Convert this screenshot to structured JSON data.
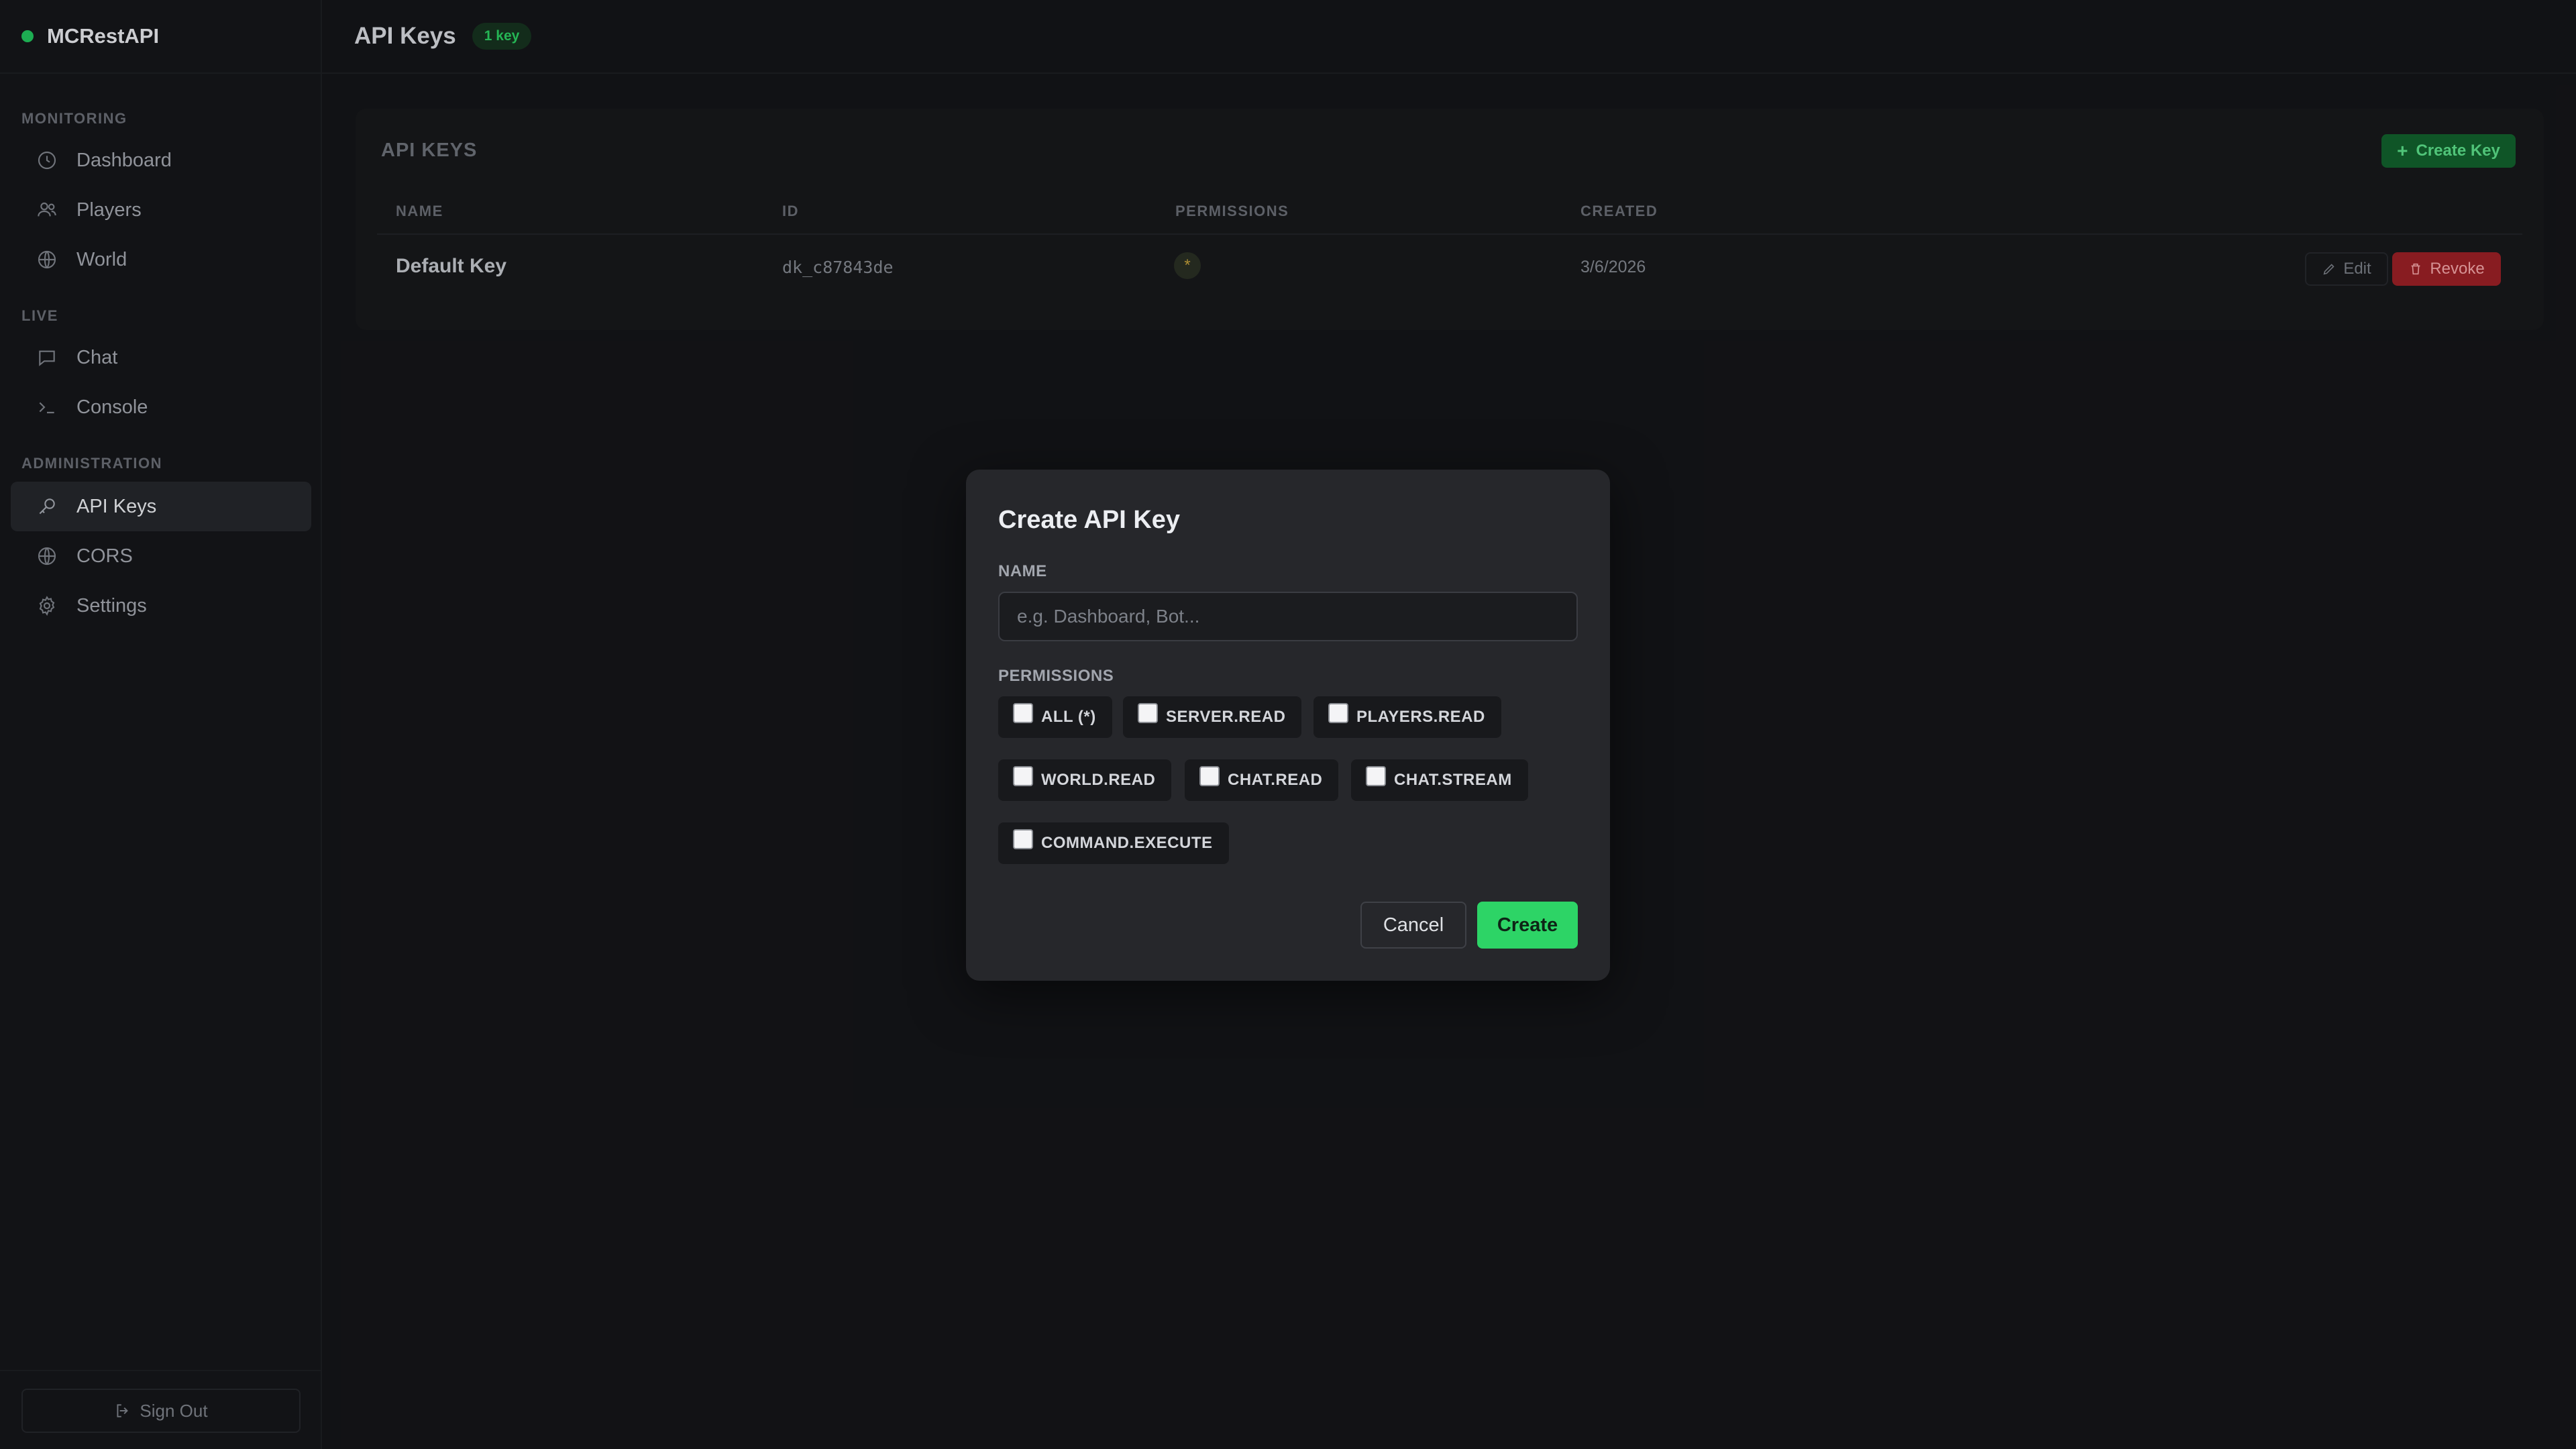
{
  "app": {
    "name": "MCRestAPI",
    "status_color": "#22c55e"
  },
  "sidebar": {
    "sections": [
      {
        "label": "MONITORING",
        "items": [
          {
            "label": "Dashboard",
            "icon": "clock-icon"
          },
          {
            "label": "Players",
            "icon": "users-icon"
          },
          {
            "label": "World",
            "icon": "globe-icon"
          }
        ]
      },
      {
        "label": "LIVE",
        "items": [
          {
            "label": "Chat",
            "icon": "chat-icon"
          },
          {
            "label": "Console",
            "icon": "terminal-icon"
          }
        ]
      },
      {
        "label": "ADMINISTRATION",
        "items": [
          {
            "label": "API Keys",
            "icon": "key-icon",
            "active": true
          },
          {
            "label": "CORS",
            "icon": "globe-icon"
          },
          {
            "label": "Settings",
            "icon": "gear-icon"
          }
        ]
      }
    ],
    "sign_out_label": "Sign Out"
  },
  "header": {
    "title": "API Keys",
    "badge": "1 key"
  },
  "keys_card": {
    "title": "API KEYS",
    "create_button": "Create Key",
    "columns": [
      "NAME",
      "ID",
      "PERMISSIONS",
      "CREATED"
    ],
    "rows": [
      {
        "name": "Default Key",
        "id": "dk_c87843de",
        "permissions": "*",
        "created": "3/6/2026"
      }
    ],
    "edit_label": "Edit",
    "revoke_label": "Revoke"
  },
  "modal": {
    "title": "Create API Key",
    "name_label": "NAME",
    "name_placeholder": "e.g. Dashboard, Bot...",
    "name_value": "",
    "permissions_label": "PERMISSIONS",
    "permissions": [
      {
        "label": "ALL (*)",
        "checked": false
      },
      {
        "label": "SERVER.READ",
        "checked": false
      },
      {
        "label": "PLAYERS.READ",
        "checked": false
      },
      {
        "label": "WORLD.READ",
        "checked": false
      },
      {
        "label": "CHAT.READ",
        "checked": false
      },
      {
        "label": "CHAT.STREAM",
        "checked": false
      },
      {
        "label": "COMMAND.EXECUTE",
        "checked": false
      }
    ],
    "cancel_label": "Cancel",
    "create_label": "Create"
  },
  "colors": {
    "accent": "#2dd466",
    "danger": "#9b2026",
    "background": "#141518"
  }
}
